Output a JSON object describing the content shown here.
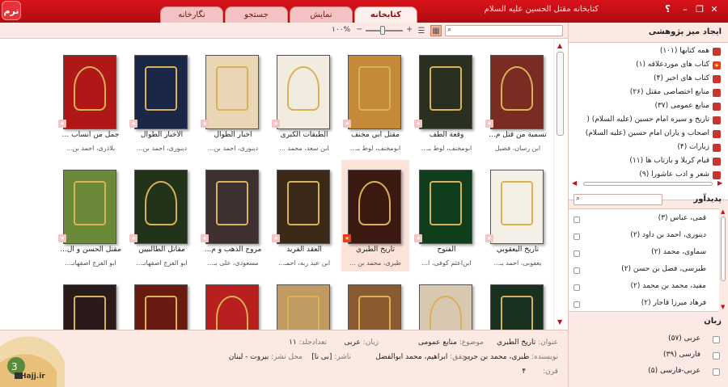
{
  "app": {
    "logo_text": "نرم",
    "window_title": "کتابخانه مقتل الحسین علیه السلام",
    "help_symbol": "؟",
    "tabs": [
      {
        "label": "کتابخانه",
        "active": true
      },
      {
        "label": "نمایش",
        "active": false
      },
      {
        "label": "جستجو",
        "active": false
      },
      {
        "label": "نگارخانه",
        "active": false
      }
    ]
  },
  "toolbar": {
    "zoom_label": "۱۰۰%",
    "search_placeholder": ""
  },
  "books": [
    {
      "title": "تسمیة من قتل م...",
      "author": "ابن رسان، فضیل",
      "cover": "#7a2b22"
    },
    {
      "title": "وقعة الطف",
      "author": "ابومخنف، لوط بـ...",
      "cover": "#2a3020"
    },
    {
      "title": "مقتل أبي مخنف",
      "author": "ابومخنف، لوط بـ...",
      "cover": "#c48a3a"
    },
    {
      "title": "الطبقات الكبرى",
      "author": "ابن سعد، محمد ...",
      "cover": "#f2ece0"
    },
    {
      "title": "أخبار الطوال",
      "author": "دینوری، احمد بن...",
      "cover": "#e8d6b4"
    },
    {
      "title": "الأخبار الطوال",
      "author": "دینوری، احمد بن...",
      "cover": "#1b2746"
    },
    {
      "title": "جمل من أنساب ...",
      "author": "بلاذری، احمد بن...",
      "cover": "#b01818"
    },
    {
      "title": "تاريخ اليعقوبي",
      "author": "یعقوبی، احمد بـ...",
      "cover": "#f4f0e6"
    },
    {
      "title": "الفتوح",
      "author": "ابن‌اعثم کوفی، ا...",
      "cover": "#103d1c"
    },
    {
      "title": "تاريخ الطبري",
      "author": "طبری، محمد بن ...",
      "cover": "#3a1a10"
    },
    {
      "title": "العقد الفريد",
      "author": "ابن عبد ربه، احمـ...",
      "cover": "#3b2a1a"
    },
    {
      "title": "مروج الذهب و م...",
      "author": "مسعودی، علی بـ...",
      "cover": "#3e3030"
    },
    {
      "title": "مقاتل الطالبيين",
      "author": "ابو الفرج اصفهانـ...",
      "cover": "#213318"
    },
    {
      "title": "مقتل الحسن و ال...",
      "author": "ابو الفرج اصفهانـ...",
      "cover": "#6a8a3a"
    },
    {
      "title": "",
      "author": "",
      "cover": "#1a3020"
    },
    {
      "title": "",
      "author": "",
      "cover": "#d8c8b0"
    },
    {
      "title": "",
      "author": "",
      "cover": "#8a5a30"
    },
    {
      "title": "",
      "author": "",
      "cover": "#c09a60"
    },
    {
      "title": "",
      "author": "",
      "cover": "#b82020"
    },
    {
      "title": "",
      "author": "",
      "cover": "#6a1a10"
    },
    {
      "title": "",
      "author": "",
      "cover": "#2a1a1a"
    }
  ],
  "selected_book_index": 9,
  "detail": {
    "title_label": "عنوان:",
    "title_value": "تاريخ الطبري",
    "topic_label": "موضوع:",
    "topic_value": "منابع عمومی",
    "lang_label": "زبان:",
    "lang_value": "عربی",
    "vol_label": "تعدادجلد:",
    "vol_value": "۱۱",
    "author_label": "نویسنده:",
    "author_value": "طبری، محمد بن جریر",
    "editor_label": "محقق:",
    "editor_value": "ابراهیم، محمد ابوالفضل",
    "publisher_label": "ناشر:",
    "publisher_value": "[بی نا]",
    "place_label": "محل نشر:",
    "place_value": "بیروت - لبنان",
    "century_label": "قرن:",
    "century_value": "۴",
    "brand": "Hajj.ir"
  },
  "rpanel": {
    "desk_title": "ایجاد میز پژوهشی",
    "collections": [
      {
        "label": "همه کتابها (۱۰۱)",
        "icon": "book-icon"
      },
      {
        "label": "کتاب های موردعلاقه (۱)",
        "icon": "star-icon"
      },
      {
        "label": "کتاب های اخیر (۴)",
        "icon": "book-icon"
      },
      {
        "label": "منابع اختصاصی مقتل (۲۶)",
        "icon": "book-icon"
      },
      {
        "label": "منابع عمومی (۳۷)",
        "icon": "book-icon"
      },
      {
        "label": "تاریخ و سیره امام حسین (علیه السلام) (",
        "icon": "book-icon"
      },
      {
        "label": "اصحاب و یاران امام حسین (علیه السلام)",
        "icon": "book-icon"
      },
      {
        "label": "زیارات (۴)",
        "icon": "book-icon"
      },
      {
        "label": "قیام کربلا و بازتاب ها (۱۱)",
        "icon": "book-icon"
      },
      {
        "label": "شعر و ادب عاشورا (۹)",
        "icon": "book-icon"
      }
    ],
    "creator_title": "پدیدآور",
    "creators": [
      "قمی، عباس (۳)",
      "دینوری، احمد بن داود (۲)",
      "سماوی، محمد (۲)",
      "طبرسی، فضل بن حسن (۲)",
      "مفید، محمد بن محمد (۲)",
      "فرهاد میرزا قاجار (۲)"
    ],
    "language_title": "زبان",
    "languages": [
      "عربی (۵۷)",
      "فارسی (۳۹)",
      "عربی-فارسی (۵)"
    ]
  }
}
